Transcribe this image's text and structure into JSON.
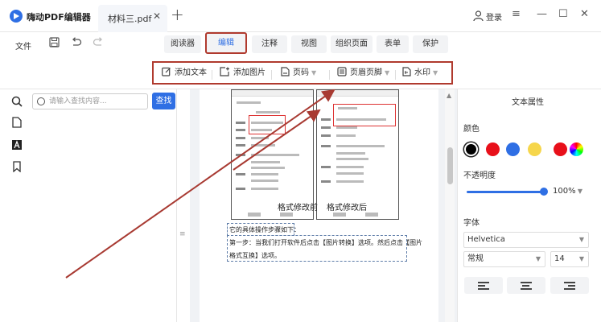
{
  "app": {
    "title": "嗨动PDF编辑器",
    "file_tab": "材料三.pdf",
    "file_tab_close": "✕",
    "new_tab": "+",
    "login": "登录",
    "window_controls": {
      "menu": "≡",
      "minimize": "—",
      "maximize": "☐",
      "close": "✕"
    }
  },
  "menubar": {
    "file": "文件",
    "icons": {
      "save": "save-icon",
      "undo": "undo-icon",
      "redo": "redo-icon"
    },
    "nav": [
      "阅读器",
      "编辑",
      "注释",
      "视图",
      "组织页面",
      "表单",
      "保护"
    ],
    "active": "编辑"
  },
  "toolbar": {
    "add_text": "添加文本",
    "add_image": "添加图片",
    "page_number": "页码",
    "header_footer": "页眉页脚",
    "watermark": "水印"
  },
  "search": {
    "placeholder": "请输入查找内容...",
    "button": "查找"
  },
  "document": {
    "caption_before": "格式修改前",
    "caption_after": "格式修改后",
    "step_intro": "它的具体操作步骤如下：",
    "step1_line1": "第一步：当我们打开软件后点击【图片转换】选项。然后点击【图片",
    "step1_line2": "格式互换】选项。"
  },
  "properties": {
    "title": "文本属性",
    "color_label": "颜色",
    "colors": [
      "#000000",
      "#e8101a",
      "#2f6fe4",
      "#f6d64b",
      "#e8101a",
      "rainbow"
    ],
    "opacity_label": "不透明度",
    "opacity_value": "100%",
    "opacity_fraction": 1.0,
    "font_label": "字体",
    "font_family": "Helvetica",
    "font_style": "常规",
    "font_size": "14"
  }
}
